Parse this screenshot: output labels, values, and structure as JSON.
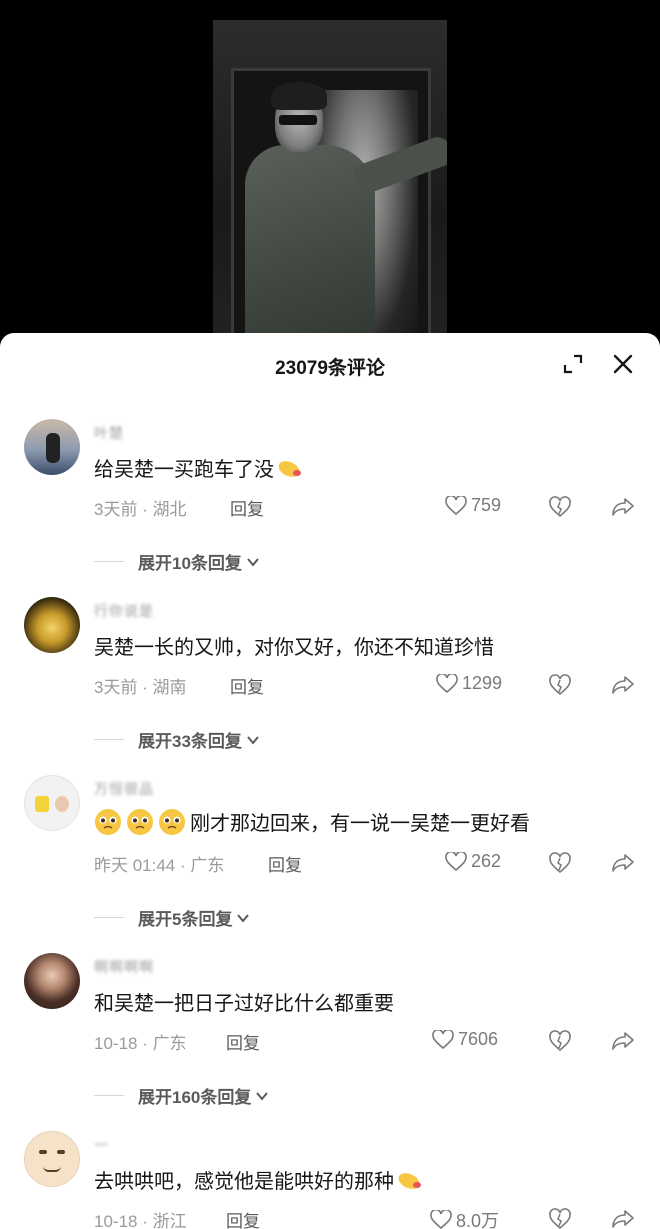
{
  "sheet": {
    "title": "23079条评论"
  },
  "comments": [
    {
      "username": "叶楚",
      "text": "给吴楚一买跑车了没",
      "time_location": "3天前 · 湖北",
      "reply_label": "回复",
      "likes": "759",
      "expand_label": "展开10条回复"
    },
    {
      "username": "行你说是",
      "text": "吴楚一长的又帅，对你又好，你还不知道珍惜",
      "time_location": "3天前 · 湖南",
      "reply_label": "回复",
      "likes": "1299",
      "expand_label": "展开33条回复"
    },
    {
      "username": "万恒很品",
      "text": "刚才那边回来，有一说一吴楚一更好看",
      "time_location": "昨天 01:44 · 广东",
      "reply_label": "回复",
      "likes": "262",
      "expand_label": "展开5条回复"
    },
    {
      "username": "啊啊啊啊",
      "text": "和吴楚一把日子过好比什么都重要",
      "time_location": "10-18 · 广东",
      "reply_label": "回复",
      "likes": "7606",
      "expand_label": "展开160条回复"
    },
    {
      "username": "一",
      "text": "去哄哄吧，感觉他是能哄好的那种",
      "time_location": "10-18 · 浙江",
      "reply_label": "回复",
      "likes": "8.0万"
    }
  ],
  "icons": {
    "expand": "expand-icon",
    "close": "close-icon",
    "like": "heart-outline-icon",
    "dislike": "broken-heart-icon",
    "share": "share-arrow-icon",
    "emoji_hand": "pointing-hand-emoji",
    "emoji_pleading": "pleading-face-emoji"
  },
  "colors": {
    "text_primary": "#161616",
    "text_secondary": "#9a9a9a",
    "background": "#ffffff"
  }
}
